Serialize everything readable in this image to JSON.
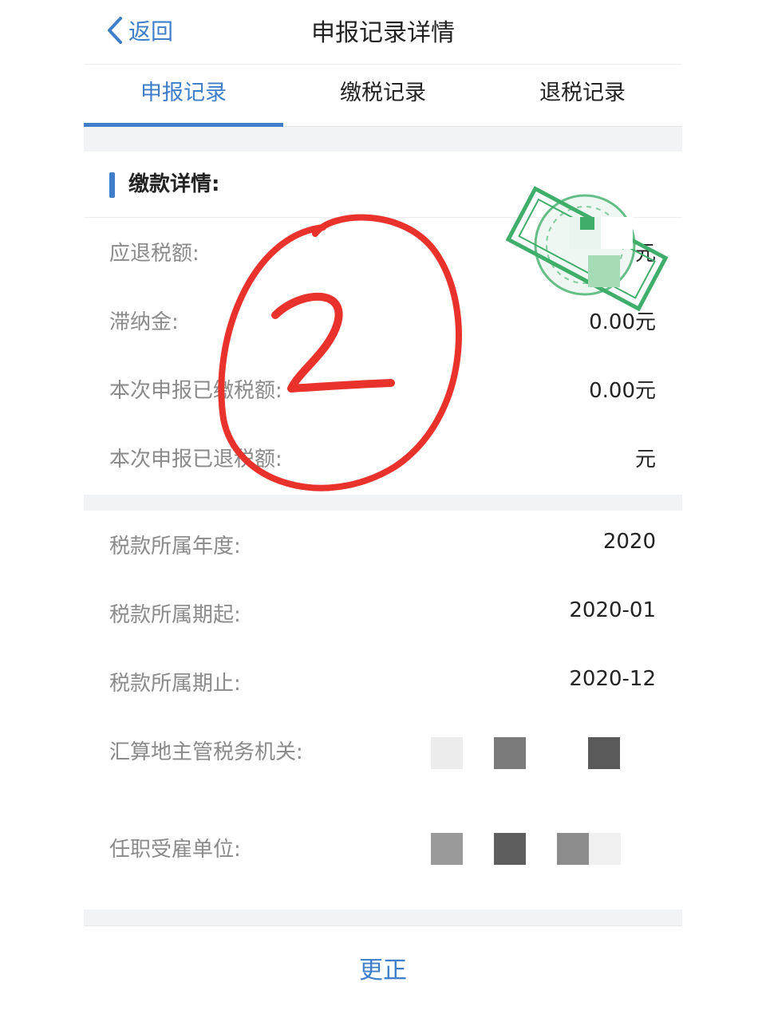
{
  "header": {
    "back_label": "返回",
    "title": "申报记录详情"
  },
  "tabs": [
    {
      "label": "申报记录",
      "active": true
    },
    {
      "label": "缴税记录",
      "active": false
    },
    {
      "label": "退税记录",
      "active": false
    }
  ],
  "section": {
    "title": "缴款详情:"
  },
  "payment_rows": [
    {
      "label": "应退税额:",
      "value": "元"
    },
    {
      "label": "滞纳金:",
      "value": "0.00元"
    },
    {
      "label": "本次申报已缴税额:",
      "value": "0.00元"
    },
    {
      "label": "本次申报已退税额:",
      "value": "元"
    }
  ],
  "period_rows": [
    {
      "label": "税款所属年度:",
      "value": "2020"
    },
    {
      "label": "税款所属期起:",
      "value": "2020-01"
    },
    {
      "label": "税款所属期止:",
      "value": "2020-12"
    },
    {
      "label": "汇算地主管税务机关:",
      "value": ""
    },
    {
      "label": "任职受雇单位:",
      "value": ""
    }
  ],
  "annotation": {
    "text": "2",
    "color": "#e8322b"
  },
  "footer": {
    "button_label": "更正"
  },
  "colors": {
    "accent": "#3f7ec9",
    "stamp_green": "#3fae6a",
    "label_gray": "#8a8a8a"
  }
}
